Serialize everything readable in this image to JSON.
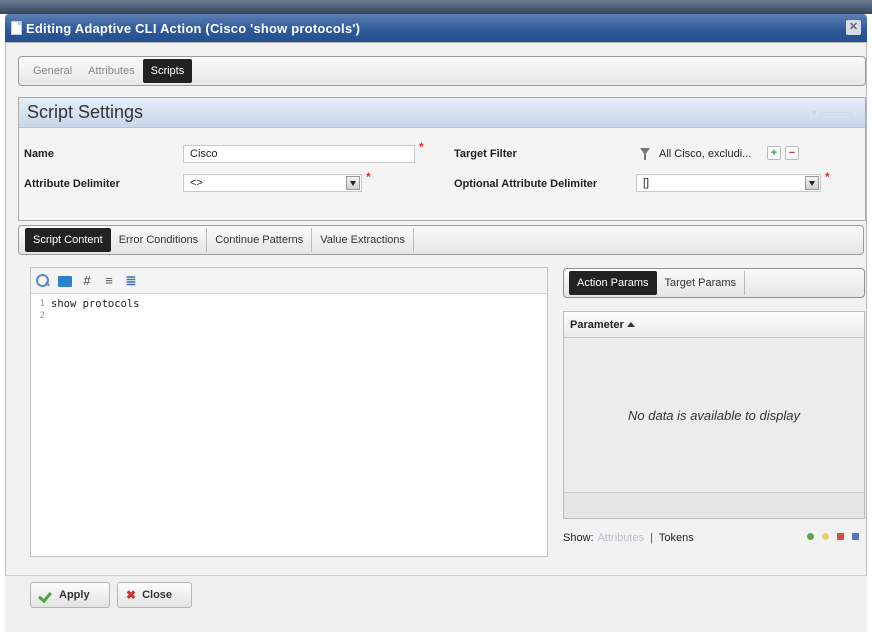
{
  "window": {
    "title": "Editing Adaptive CLI Action (Cisco 'show protocols')"
  },
  "top_tabs": [
    {
      "label": "General"
    },
    {
      "label": "Attributes"
    },
    {
      "label": "Scripts"
    }
  ],
  "settings": {
    "header": "Script Settings",
    "name_label": "Name",
    "name_value": "Cisco",
    "attr_delim_label": "Attribute Delimiter",
    "attr_delim_value": "<>",
    "target_filter_label": "Target Filter",
    "target_filter_value": "All Cisco, excludi...",
    "opt_delim_label": "Optional Attribute Delimiter",
    "opt_delim_value": "[]"
  },
  "script_tabs": [
    {
      "label": "Script Content"
    },
    {
      "label": "Error Conditions"
    },
    {
      "label": "Continue Patterns"
    },
    {
      "label": "Value Extractions"
    }
  ],
  "editor": {
    "toolbar_hash": "#",
    "lines": [
      {
        "n": "1",
        "text": "show protocols"
      },
      {
        "n": "2",
        "text": ""
      }
    ]
  },
  "params": {
    "tabs": [
      {
        "label": "Action Params"
      },
      {
        "label": "Target Params"
      }
    ],
    "column": "Parameter",
    "empty_message": "No data is available to display",
    "show_label": "Show:",
    "show_attributes": "Attributes",
    "show_sep": "|",
    "show_tokens": "Tokens"
  },
  "buttons": {
    "apply": "Apply",
    "close": "Close"
  },
  "colors": {
    "accent": "#2f5a9a",
    "required": "#d33333",
    "apply_check": "#4aa341"
  }
}
